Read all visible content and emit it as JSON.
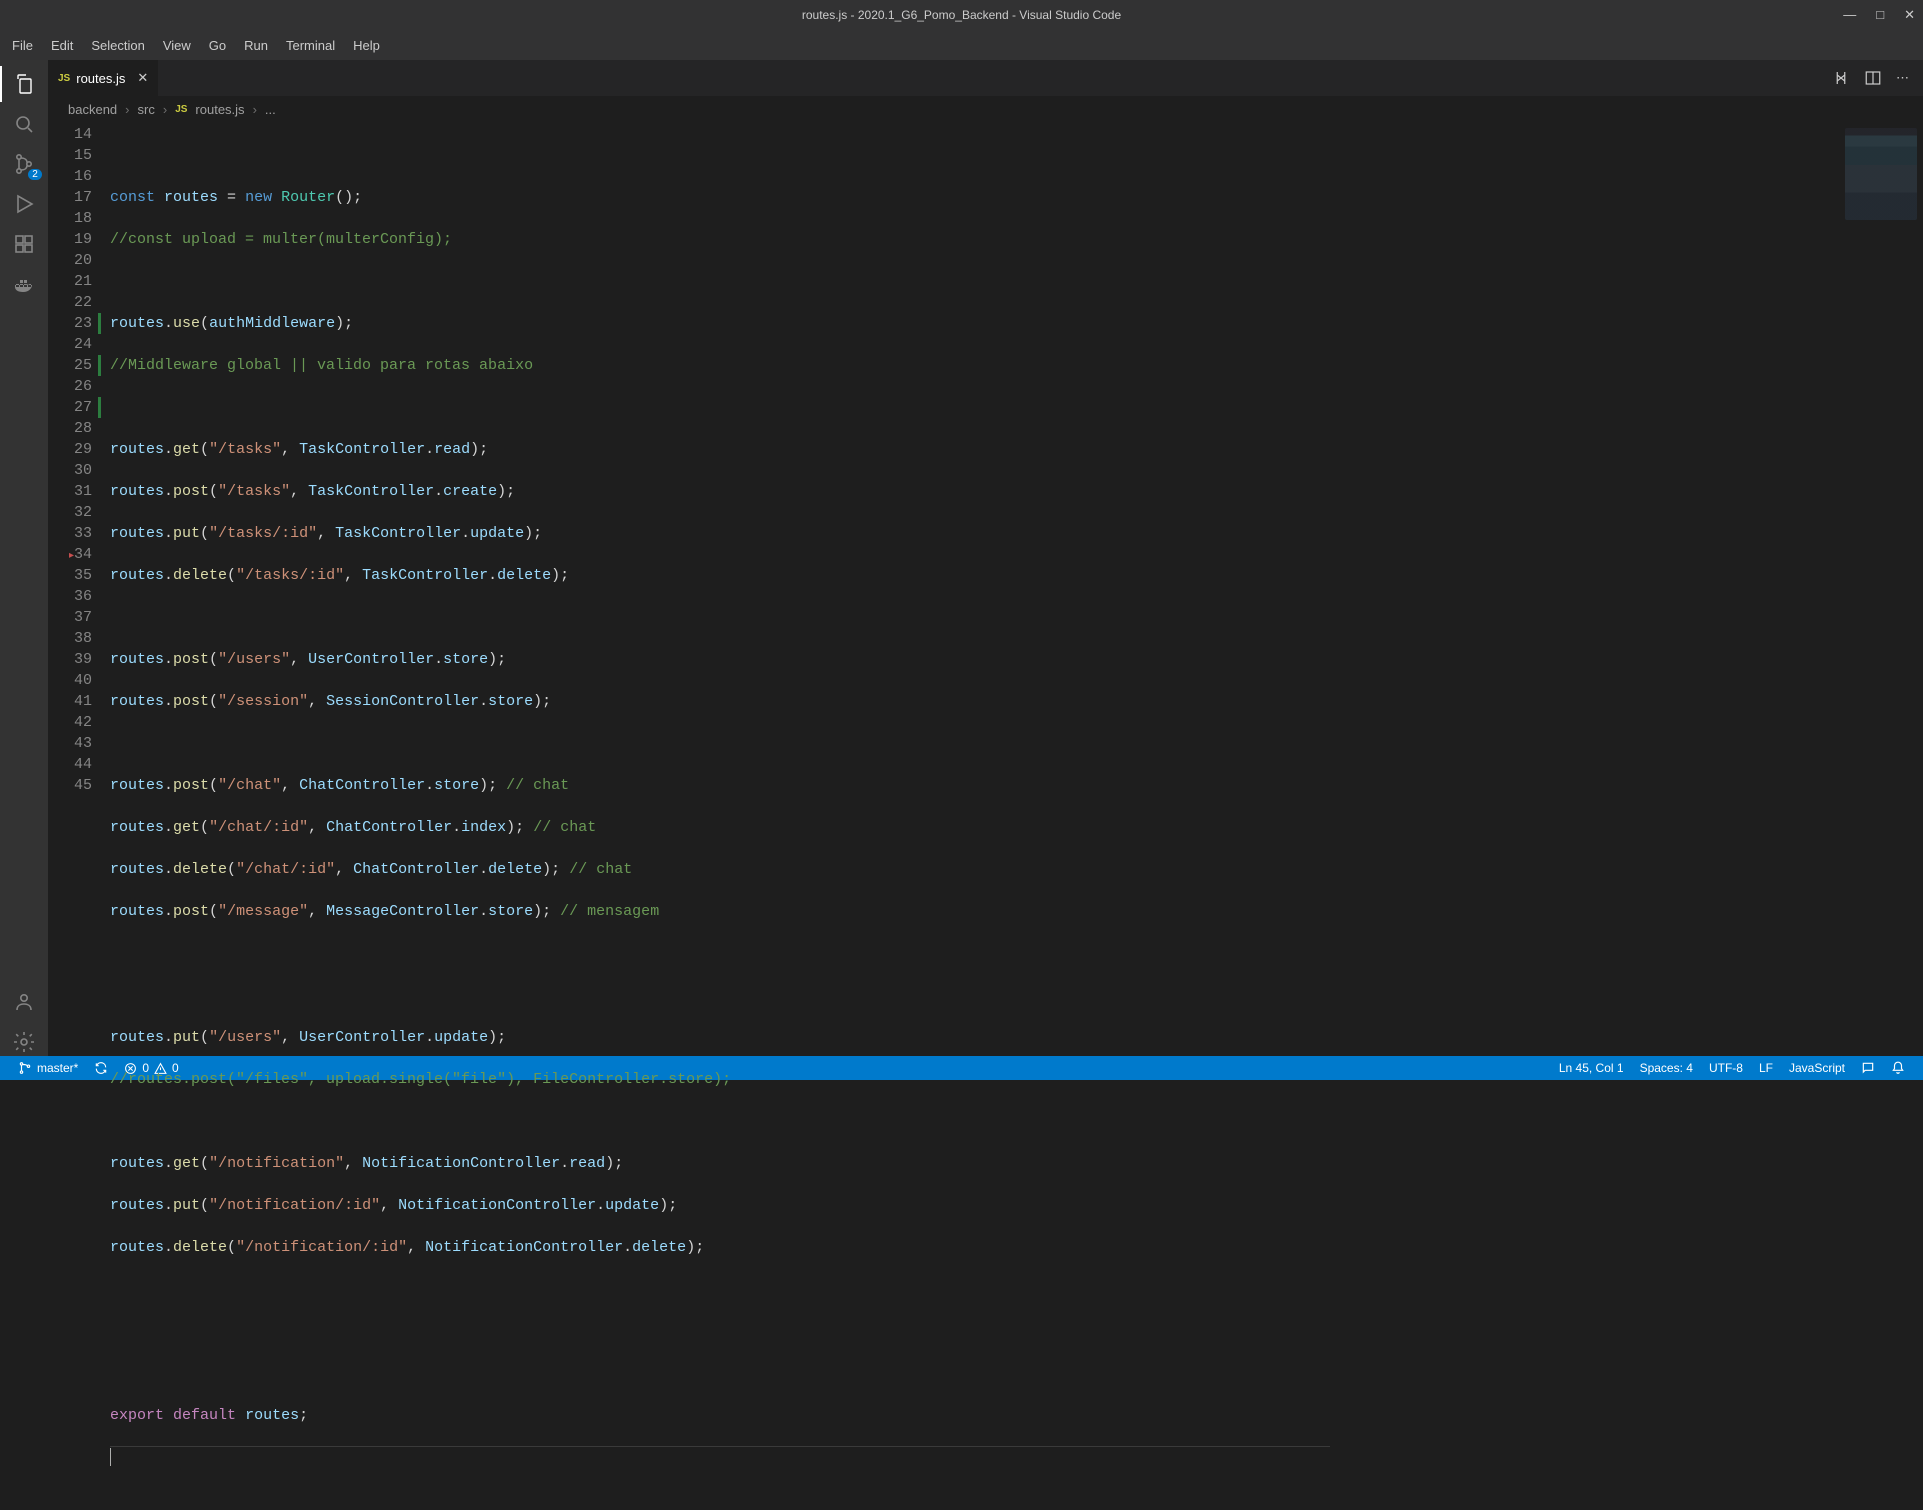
{
  "title": "routes.js - 2020.1_G6_Pomo_Backend - Visual Studio Code",
  "menu": [
    "File",
    "Edit",
    "Selection",
    "View",
    "Go",
    "Run",
    "Terminal",
    "Help"
  ],
  "activity_badge": "2",
  "tab": {
    "icon": "JS",
    "label": "routes.js"
  },
  "breadcrumbs": {
    "p1": "backend",
    "p2": "src",
    "icon": "JS",
    "p3": "routes.js",
    "p4": "..."
  },
  "line_numbers": [
    "14",
    "15",
    "16",
    "17",
    "18",
    "19",
    "20",
    "21",
    "22",
    "23",
    "24",
    "25",
    "26",
    "27",
    "28",
    "29",
    "30",
    "31",
    "32",
    "33",
    "34",
    "35",
    "36",
    "37",
    "38",
    "39",
    "40",
    "41",
    "42",
    "43",
    "44",
    "45"
  ],
  "code": {
    "l15": {
      "kw": "const",
      "v": "routes",
      "eq": " = ",
      "new": "new",
      "cls": "Router",
      "tail": "();"
    },
    "l16": "//const upload = multer(multerConfig);",
    "l18": {
      "obj": "routes",
      "dot": ".",
      "fn": "use",
      "open": "(",
      "arg": "authMiddleware",
      "close": ");"
    },
    "l19": "//Middleware global || valido para rotas abaixo",
    "l21": {
      "obj": "routes",
      "fn": "get",
      "str": "\"/tasks\"",
      "ctrl": "TaskController",
      "m": "read"
    },
    "l22": {
      "obj": "routes",
      "fn": "post",
      "str": "\"/tasks\"",
      "ctrl": "TaskController",
      "m": "create"
    },
    "l23": {
      "obj": "routes",
      "fn": "put",
      "str": "\"/tasks/:id\"",
      "ctrl": "TaskController",
      "m": "update"
    },
    "l24": {
      "obj": "routes",
      "fn": "delete",
      "str": "\"/tasks/:id\"",
      "ctrl": "TaskController",
      "m": "delete"
    },
    "l26": {
      "obj": "routes",
      "fn": "post",
      "str": "\"/users\"",
      "ctrl": "UserController",
      "m": "store"
    },
    "l27": {
      "obj": "routes",
      "fn": "post",
      "str": "\"/session\"",
      "ctrl": "SessionController",
      "m": "store"
    },
    "l29": {
      "obj": "routes",
      "fn": "post",
      "str": "\"/chat\"",
      "ctrl": "ChatController",
      "m": "store",
      "c": " // chat"
    },
    "l30": {
      "obj": "routes",
      "fn": "get",
      "str": "\"/chat/:id\"",
      "ctrl": "ChatController",
      "m": "index",
      "c": " // chat"
    },
    "l31": {
      "obj": "routes",
      "fn": "delete",
      "str": "\"/chat/:id\"",
      "ctrl": "ChatController",
      "m": "delete",
      "c": " // chat"
    },
    "l32": {
      "obj": "routes",
      "fn": "post",
      "str": "\"/message\"",
      "ctrl": "MessageController",
      "m": "store",
      "c": " // mensagem"
    },
    "l35": {
      "obj": "routes",
      "fn": "put",
      "str": "\"/users\"",
      "ctrl": "UserController",
      "m": "update"
    },
    "l36": "//routes.post(\"/files\", upload.single(\"file\"), FileController.store);",
    "l38": {
      "obj": "routes",
      "fn": "get",
      "str": "\"/notification\"",
      "ctrl": "NotificationController",
      "m": "read"
    },
    "l39": {
      "obj": "routes",
      "fn": "put",
      "str": "\"/notification/:id\"",
      "ctrl": "NotificationController",
      "m": "update"
    },
    "l40": {
      "obj": "routes",
      "fn": "delete",
      "str": "\"/notification/:id\"",
      "ctrl": "NotificationController",
      "m": "delete"
    },
    "l44": {
      "kw1": "export",
      "kw2": "default",
      "v": "routes",
      "tail": ";"
    }
  },
  "status": {
    "branch": "master*",
    "errors": "0",
    "warnings": "0",
    "pos": "Ln 45, Col 1",
    "spaces": "Spaces: 4",
    "enc": "UTF-8",
    "eol": "LF",
    "lang": "JavaScript"
  }
}
